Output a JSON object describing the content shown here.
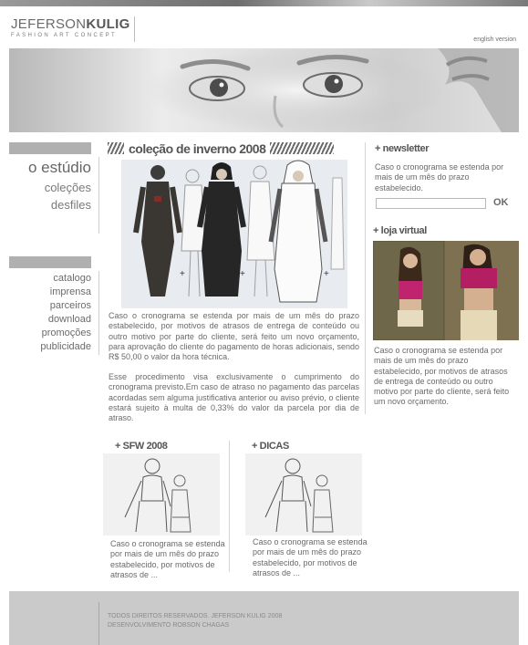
{
  "header": {
    "logo_first": "JEFERSON",
    "logo_second": "KULIG",
    "logo_tagline": "FASHION ART CONCEPT",
    "english_link": "english version"
  },
  "nav": {
    "primary": [
      "o estúdio",
      "coleções",
      "desfiles"
    ],
    "secondary": [
      "catalogo",
      "imprensa",
      "parceiros",
      "download",
      "promoções",
      "publicidade"
    ]
  },
  "main": {
    "title": "coleção de inverno 2008",
    "paragraph1": "Caso o cronograma se estenda por mais de um mês do prazo estabelecido, por motivos de atrasos de entrega de conteúdo ou outro motivo por parte do cliente, será feito um novo orçamento, para aprovação do cliente do pagamento de horas adicionais, sendo R$ 50,00 o valor da hora técnica.",
    "paragraph2": "Esse procedimento visa exclusivamente o cumprimento do cronograma previsto.Em caso de atraso no pagamento das parcelas acordadas sem alguma justificativa anterior ou aviso prévio, o cliente estará sujeito à multa de 0,33% do valor da parcela por dia de atraso."
  },
  "newsletter": {
    "title": "+ newsletter",
    "text": "Caso o cronograma se estenda por mais de um mês do prazo estabelecido.",
    "input_value": "",
    "ok_label": "OK"
  },
  "loja": {
    "title": "+ loja virtual",
    "text": "Caso o cronograma se estenda por mais de um mês do prazo estabelecido, por motivos de atrasos de entrega de conteúdo ou outro motivo por parte do cliente, será feito um novo orçamento."
  },
  "sfw": {
    "title": "+ SFW 2008",
    "text": "Caso o cronograma se estenda por mais de um mês do prazo estabelecido, por motivos de atrasos de ..."
  },
  "dicas": {
    "title": "+ DICAS",
    "text": "Caso o cronograma se estenda por mais de um mês do prazo estabelecido, por motivos de atrasos de ..."
  },
  "footer": {
    "line1": "TODOS DIREITOS RESERVADOS. JEFERSON KULIG 2008",
    "line2": "DESENVOLVIMENTO ROBSON CHAGAS"
  }
}
